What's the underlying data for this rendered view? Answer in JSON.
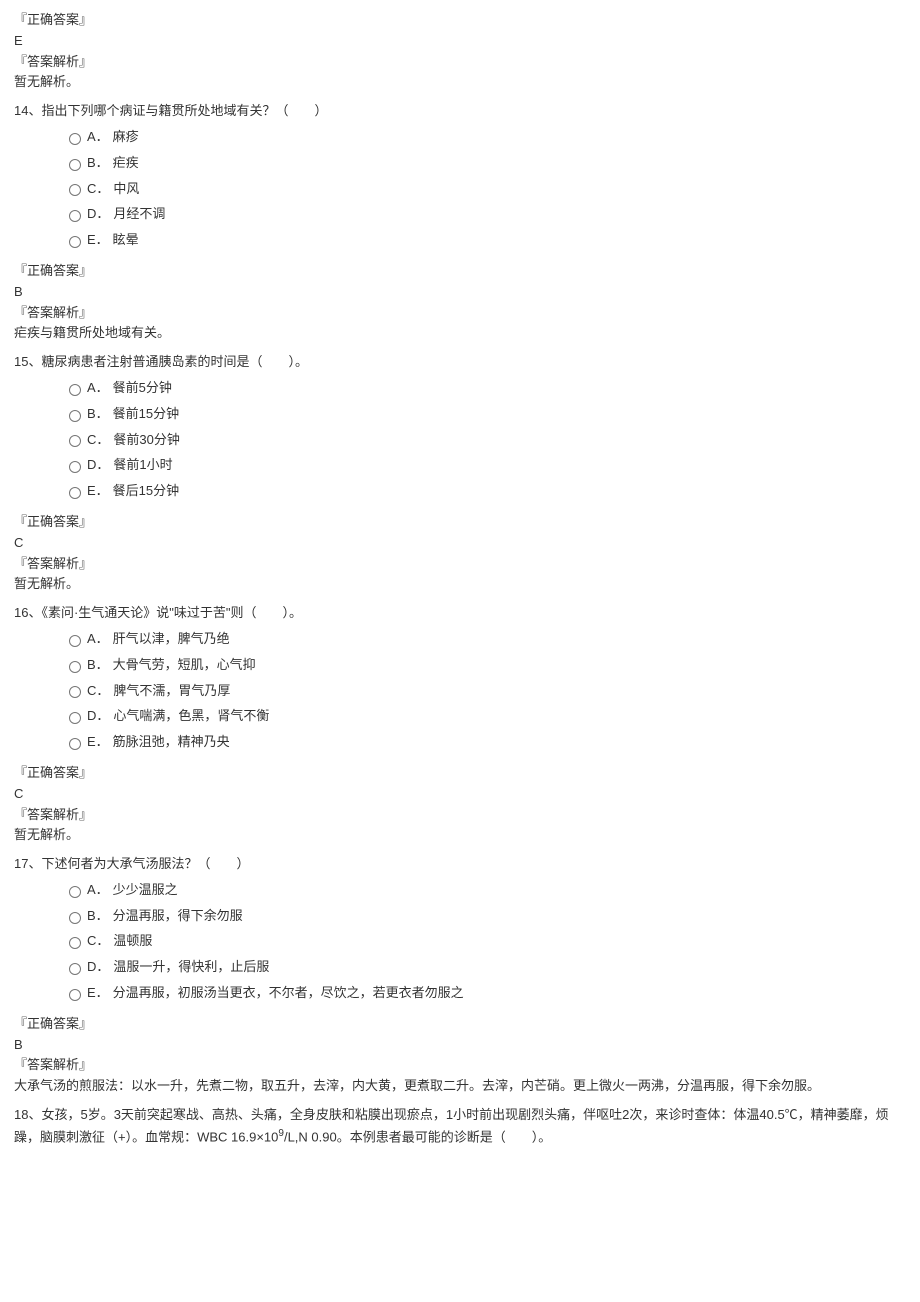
{
  "labels": {
    "correct_answer": "『正确答案』",
    "explanation": "『答案解析』",
    "no_explanation": "暂无解析。"
  },
  "q13_answer": {
    "letter": "E"
  },
  "q14": {
    "stem": "14、指出下列哪个病证与籍贯所处地域有关？（　　）",
    "options": {
      "A": "麻疹",
      "B": "疟疾",
      "C": "中风",
      "D": "月经不调",
      "E": "眩晕"
    },
    "answer_letter": "B",
    "explanation": "疟疾与籍贯所处地域有关。"
  },
  "q15": {
    "stem": "15、糖尿病患者注射普通胰岛素的时间是（　　）。",
    "options": {
      "A": "餐前5分钟",
      "B": "餐前15分钟",
      "C": "餐前30分钟",
      "D": "餐前1小时",
      "E": "餐后15分钟"
    },
    "answer_letter": "C"
  },
  "q16": {
    "stem": "16、《素问·生气通天论》说\"味过于苦\"则（　　）。",
    "options": {
      "A": "肝气以津，脾气乃绝",
      "B": "大骨气劳，短肌，心气抑",
      "C": "脾气不濡，胃气乃厚",
      "D": "心气喘满，色黑，肾气不衡",
      "E": "筋脉沮弛，精神乃央"
    },
    "answer_letter": "C"
  },
  "q17": {
    "stem": "17、下述何者为大承气汤服法？（　　）",
    "options": {
      "A": "少少温服之",
      "B": "分温再服，得下余勿服",
      "C": "温顿服",
      "D": "温服一升，得快利，止后服",
      "E": "分温再服，初服汤当更衣，不尔者，尽饮之，若更衣者勿服之"
    },
    "answer_letter": "B",
    "explanation": "大承气汤的煎服法：以水一升，先煮二物，取五升，去滓，内大黄，更煮取二升。去滓，内芒硝。更上微火一两沸，分温再服，得下余勿服。"
  },
  "q18": {
    "stem_part1": "18、女孩，5岁。3天前突起寒战、高热、头痛，全身皮肤和粘膜出现瘀点，1小时前出现剧烈头痛，伴呕吐2次，来诊时查体：体温40.5℃，精神萎靡，烦躁，脑膜刺激征（+）。血常规：WBC 16.9×10",
    "stem_sup": "9",
    "stem_part2": "/L,N 0.90。本例患者最可能的诊断是（　　）。"
  }
}
